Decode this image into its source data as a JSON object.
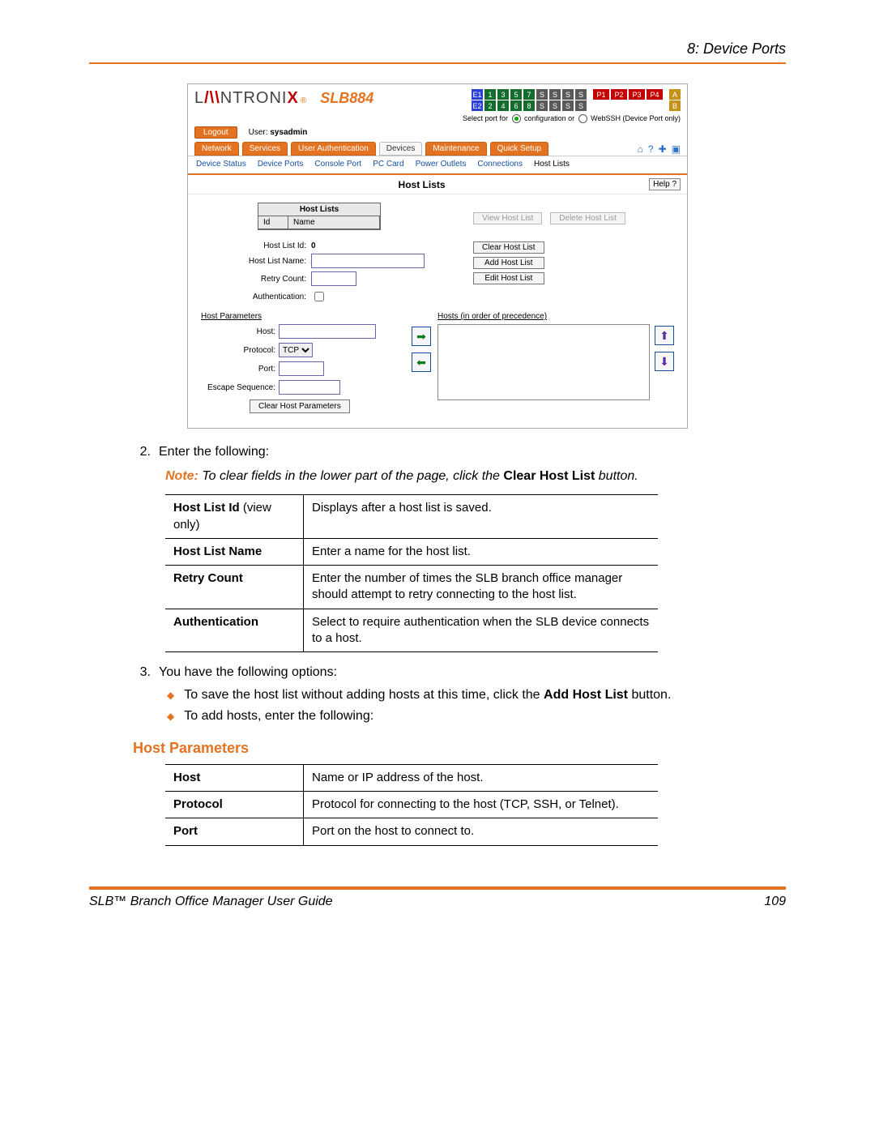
{
  "doc": {
    "header_right": "8: Device Ports",
    "step2_num": "2.",
    "step2_text": "Enter the following:",
    "note_label": "Note:",
    "note_text_before": "To clear fields in the lower part of the page, click the ",
    "note_bold": "Clear Host List",
    "note_text_after": " button.",
    "table1": [
      {
        "k": "Host List Id",
        "ksub": " (view only)",
        "v": "Displays after a host list is saved."
      },
      {
        "k": "Host List Name",
        "ksub": "",
        "v": "Enter a name for the host list."
      },
      {
        "k": "Retry Count",
        "ksub": "",
        "v": "Enter the number of times the SLB branch office manager should attempt to retry connecting to the host list."
      },
      {
        "k": "Authentication",
        "ksub": "",
        "v": "Select to require authentication when the SLB device connects to a host."
      }
    ],
    "step3_num": "3.",
    "step3_text": "You have the following options:",
    "bullet1_before": "To save the host list without adding hosts at this time, click the ",
    "bullet1_bold": "Add Host List",
    "bullet1_after": " button.",
    "bullet2": "To add hosts, enter the following:",
    "section_heading": "Host Parameters",
    "table2": [
      {
        "k": "Host",
        "v": "Name or IP address of the host."
      },
      {
        "k": "Protocol",
        "v": "Protocol for connecting to the host (TCP, SSH, or Telnet)."
      },
      {
        "k": "Port",
        "v": "Port on the host to connect to."
      }
    ],
    "footer_left": "SLB™ Branch Office Manager User Guide",
    "footer_right": "109"
  },
  "app": {
    "brand_primary": "L",
    "brand_secondary": "NTRONI",
    "brand_accent": "X",
    "model": "SLB884",
    "logout": "Logout",
    "user_label": "User:",
    "user_value": "sysadmin",
    "port_e1": "E1",
    "port_e2": "E2",
    "port_hint_before": "Select port for",
    "port_hint_cfg": "configuration or",
    "port_hint_ws": "WebSSH (Device Port only)",
    "tabs": {
      "network": "Network",
      "services": "Services",
      "auth": "User Authentication",
      "devices": "Devices",
      "maint": "Maintenance",
      "quick": "Quick Setup"
    },
    "icons": {
      "home": "⌂",
      "help": "?",
      "add": "✚",
      "win": "▣"
    },
    "subnav": {
      "ds": "Device Status",
      "dp": "Device Ports",
      "cp": "Console Port",
      "pc": "PC Card",
      "po": "Power Outlets",
      "cn": "Connections",
      "hl": "Host Lists"
    },
    "title": "Host Lists",
    "help_btn": "Help ?",
    "hl_table_title": "Host Lists",
    "hl_col1": "Id",
    "hl_col2": "Name",
    "btn_view": "View Host List",
    "btn_delete": "Delete Host List",
    "lbl_hlid": "Host List Id:",
    "val_hlid": "0",
    "lbl_hlname": "Host List Name:",
    "lbl_retry": "Retry Count:",
    "lbl_auth": "Authentication:",
    "btn_clear": "Clear Host List",
    "btn_add": "Add Host List",
    "btn_edit": "Edit Host List",
    "hp_heading": "Host Parameters",
    "lbl_host": "Host:",
    "lbl_proto": "Protocol:",
    "lbl_port": "Port:",
    "lbl_esc": "Escape Sequence:",
    "proto_val": "TCP",
    "btn_clearhp": "Clear Host Parameters",
    "hosts_heading_u": "Hosts",
    "hosts_heading_rest": " (in order of precedence)",
    "ports_nums": [
      "1",
      "3",
      "5",
      "7",
      "2",
      "4",
      "6",
      "8"
    ],
    "ports_p": [
      "P1",
      "P2",
      "P3",
      "P4"
    ],
    "ports_ab": [
      "A",
      "B"
    ]
  }
}
